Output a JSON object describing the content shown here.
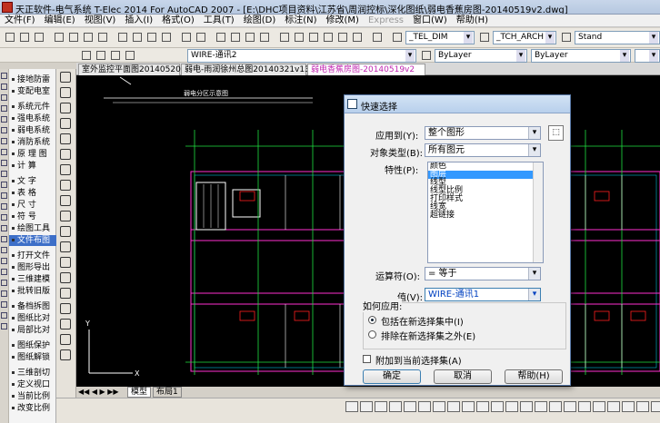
{
  "window": {
    "title": "天正软件-电气系统 T-Elec 2014  For AutoCAD 2007 - [E:\\DHC项目资料\\江苏省\\周润控标\\深化图纸\\弱电香蕉房图-20140519v2.dwg]"
  },
  "menu": [
    {
      "label": "文件(F)",
      "enabled": true
    },
    {
      "label": "编辑(E)",
      "enabled": true
    },
    {
      "label": "视图(V)",
      "enabled": true
    },
    {
      "label": "插入(I)",
      "enabled": true
    },
    {
      "label": "格式(O)",
      "enabled": true
    },
    {
      "label": "工具(T)",
      "enabled": true
    },
    {
      "label": "绘图(D)",
      "enabled": true
    },
    {
      "label": "标注(N)",
      "enabled": true
    },
    {
      "label": "修改(M)",
      "enabled": true
    },
    {
      "label": "Express",
      "enabled": false
    },
    {
      "label": "窗口(W)",
      "enabled": true
    },
    {
      "label": "帮助(H)",
      "enabled": true
    }
  ],
  "toolbar": {
    "textstyle": "_TEL_DIM",
    "dimstyle": "_TCH_ARCH",
    "standard": "Stand",
    "layer": "WIRE-通讯2",
    "color": "ByLayer",
    "linetype": "ByLayer"
  },
  "doc_tabs": [
    {
      "label": "室外监控平面图20140520",
      "active": false
    },
    {
      "label": "弱电-雨润徐州总图20140321v13",
      "active": false
    },
    {
      "label": "弱电香蕉房图-20140519v2",
      "active": true
    }
  ],
  "left_panel": [
    {
      "label": "接地防雷",
      "selected": false
    },
    {
      "label": "变配电室",
      "selected": false
    },
    {
      "label": "系统元件",
      "selected": false
    },
    {
      "label": "强电系统",
      "selected": false
    },
    {
      "label": "弱电系统",
      "selected": false
    },
    {
      "label": "消防系统",
      "selected": false
    },
    {
      "label": "原 理 图",
      "selected": false
    },
    {
      "label": "计    算",
      "selected": false
    },
    {
      "label": "文    字",
      "selected": false
    },
    {
      "label": "表    格",
      "selected": false
    },
    {
      "label": "尺    寸",
      "selected": false
    },
    {
      "label": "符    号",
      "selected": false
    },
    {
      "label": "绘图工具",
      "selected": false
    },
    {
      "label": "文件布图",
      "selected": true
    },
    {
      "label": "打开文件",
      "selected": false
    },
    {
      "label": "图形导出",
      "selected": false
    },
    {
      "label": "三维建模",
      "selected": false
    },
    {
      "label": "批转旧版",
      "selected": false
    },
    {
      "label": "备档拆图",
      "selected": false
    },
    {
      "label": "图纸比对",
      "selected": false
    },
    {
      "label": "局部比对",
      "selected": false
    },
    {
      "label": "图纸保护",
      "selected": false
    },
    {
      "label": "图纸解锁",
      "selected": false
    },
    {
      "label": "三维剖切",
      "selected": false
    },
    {
      "label": "定义视口",
      "selected": false
    },
    {
      "label": "当前比例",
      "selected": false
    },
    {
      "label": "改变比例",
      "selected": false
    }
  ],
  "drawing": {
    "label": "弱电分区示意图"
  },
  "model_tabs": [
    "模型",
    "布局1"
  ],
  "dialog": {
    "title": "快速选择",
    "apply_to_label": "应用到(Y):",
    "apply_to": "整个图形",
    "object_type_label": "对象类型(B):",
    "object_type": "所有图元",
    "properties_label": "特性(P):",
    "properties": [
      {
        "label": "颜色",
        "selected": false
      },
      {
        "label": "图层",
        "selected": true
      },
      {
        "label": "线型",
        "selected": false
      },
      {
        "label": "线型比例",
        "selected": false
      },
      {
        "label": "打印样式",
        "selected": false
      },
      {
        "label": "线宽",
        "selected": false
      },
      {
        "label": "超链接",
        "selected": false
      }
    ],
    "operator_label": "运算符(O):",
    "operator": "= 等于",
    "value_label": "值(V):",
    "value": "WIRE-通讯1",
    "how_apply_label": "如何应用:",
    "include_label": "包括在新选择集中(I)",
    "exclude_label": "排除在新选择集之外(E)",
    "include_selected": true,
    "append_label": "附加到当前选择集(A)",
    "append_checked": false,
    "ok": "确定",
    "cancel": "取消",
    "help": "帮助(H)"
  }
}
